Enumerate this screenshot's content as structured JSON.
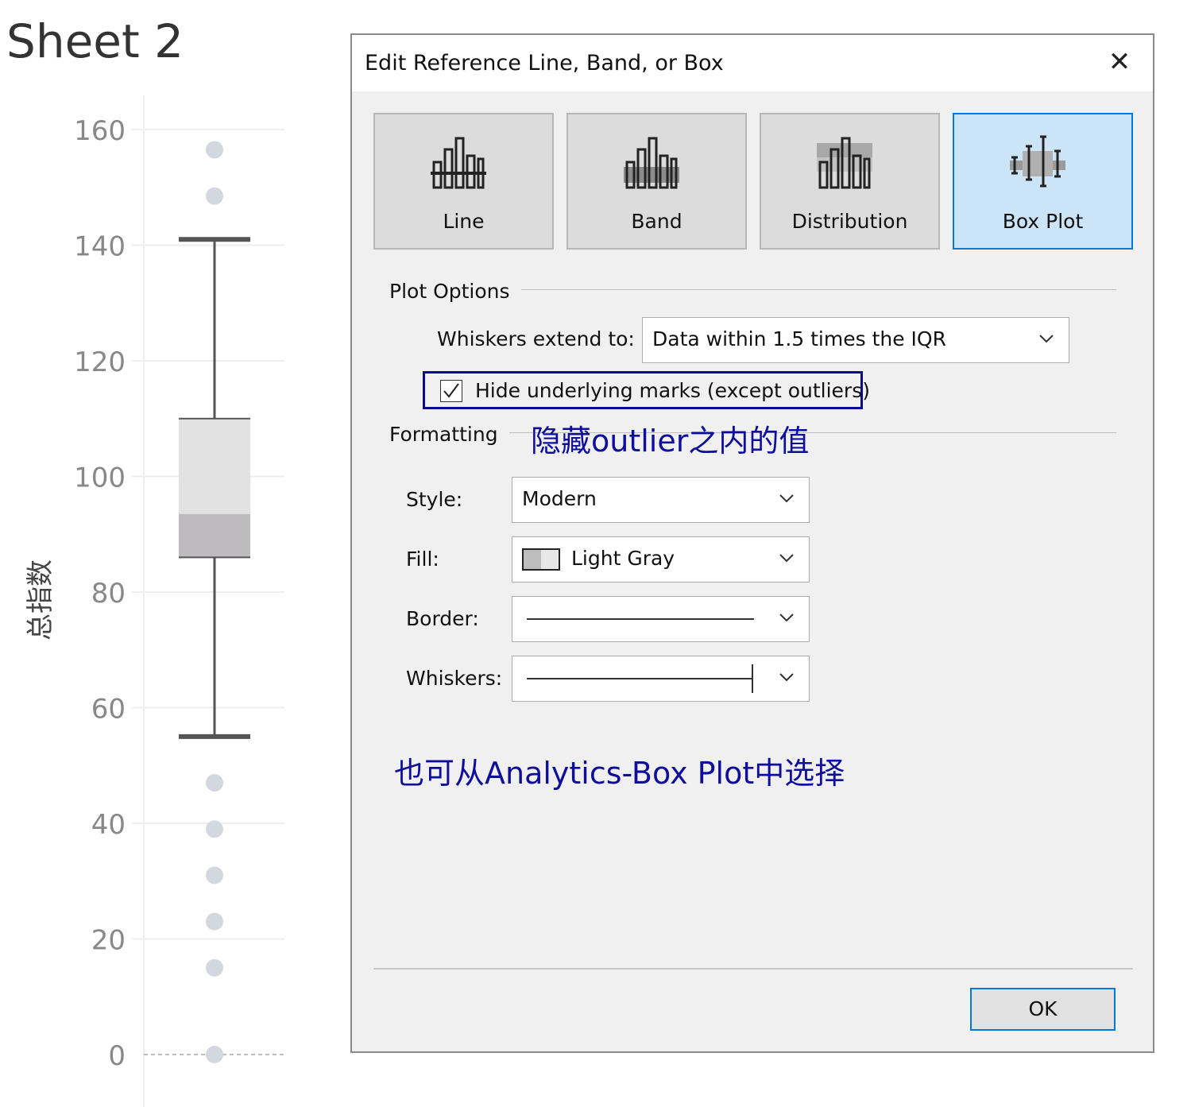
{
  "sheet": {
    "title": "Sheet 2"
  },
  "chart_data": {
    "type": "box",
    "ylabel": "总指数",
    "ylim": [
      0,
      160
    ],
    "yticks": [
      0,
      20,
      40,
      60,
      80,
      100,
      120,
      140,
      160
    ],
    "box": {
      "whisker_low": 55,
      "q1": 86,
      "median": 93.5,
      "q3": 110,
      "whisker_high": 141
    },
    "outliers": [
      156.5,
      148.5,
      47,
      39,
      31,
      23,
      15,
      0
    ],
    "colors": {
      "box_upper": "#e2e2e2",
      "box_lower": "#bdbbbd",
      "whisker": "#555555",
      "outlier": "#d3d7de",
      "grid": "#eeeeee"
    }
  },
  "dialog": {
    "title": "Edit Reference Line, Band, or Box",
    "close_glyph": "✕",
    "types": [
      {
        "label": "Line",
        "icon": "line-icon"
      },
      {
        "label": "Band",
        "icon": "band-icon"
      },
      {
        "label": "Distribution",
        "icon": "distribution-icon"
      },
      {
        "label": "Box Plot",
        "icon": "box-plot-icon",
        "selected": true
      }
    ],
    "plot_options": {
      "heading": "Plot Options",
      "whiskers_label": "Whiskers extend to:",
      "whiskers_value": "Data within 1.5 times the IQR",
      "hide_marks_label": "Hide underlying marks (except outliers)",
      "hide_marks_checked": true
    },
    "formatting": {
      "heading": "Formatting",
      "style_label": "Style:",
      "style_value": "Modern",
      "fill_label": "Fill:",
      "fill_value": "Light Gray",
      "border_label": "Border:",
      "whiskers_label": "Whiskers:"
    },
    "ok_label": "OK"
  },
  "annotations": {
    "hide_outliers_note": "隐藏outlier之内的值",
    "analytics_note": "也可从Analytics-Box Plot中选择"
  },
  "accent_color": "#0078d7",
  "annotation_color": "#0e0e9a"
}
